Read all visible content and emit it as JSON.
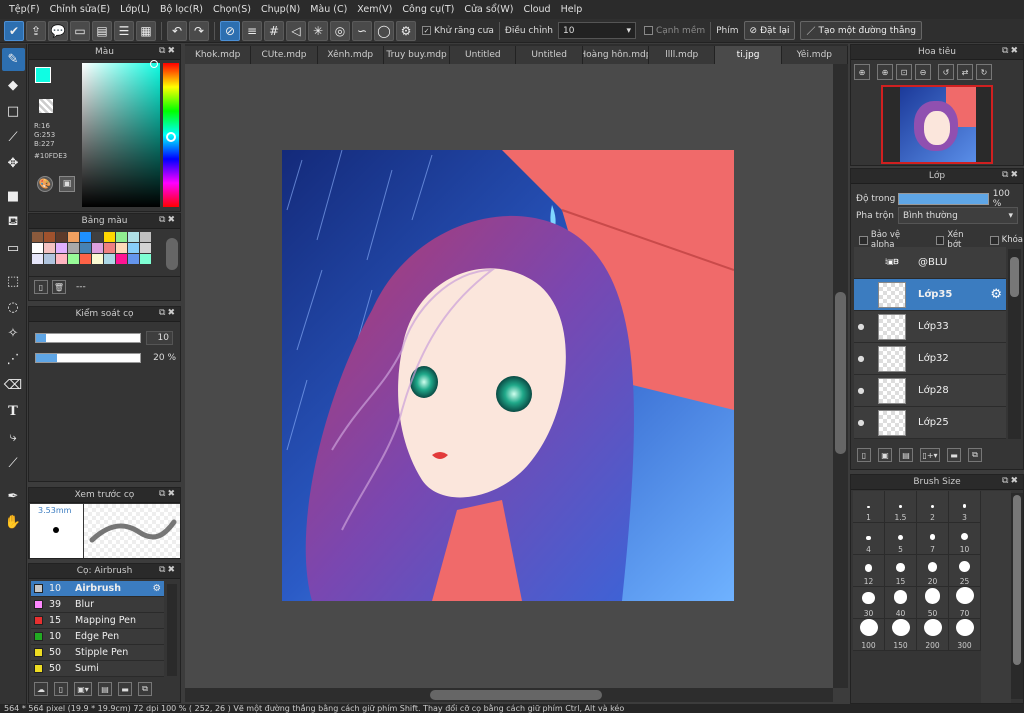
{
  "menu": [
    "Tệp(F)",
    "Chỉnh sửa(E)",
    "Lớp(L)",
    "Bộ lọc(R)",
    "Chọn(S)",
    "Chụp(N)",
    "Màu (C)",
    "Xem(V)",
    "Công cụ(T)",
    "Cửa sổ(W)",
    "Cloud",
    "Help"
  ],
  "toolbar": {
    "antialias_label": "Khử răng cưa",
    "correction_label": "Điều chỉnh",
    "correction_value": "10",
    "soft_label": "Cạnh mềm",
    "snap_label": "Phím",
    "reset_label": "Đặt lại",
    "line_label": "Tạo một đường thẳng"
  },
  "color_panel": {
    "title": "Màu",
    "r": "R:16",
    "g": "G:253",
    "b": "B:227",
    "hex": "#10FDE3",
    "current_color": "#10FDE3"
  },
  "palette_panel": {
    "title": "Bảng màu",
    "footer_text": "---",
    "colors": [
      "#8b5a3c",
      "#a0522d",
      "#5c3a2a",
      "#f0a060",
      "#1e90ff",
      "#404040",
      "#ffd700",
      "#90ee90",
      "#b0e0e6",
      "#c0c0c0",
      "#ffffff",
      "#f4c2c2",
      "#e0b0ff",
      "#a9a9a9",
      "#4682b4",
      "#dda0dd",
      "#f08080",
      "#ffdab9",
      "#87cefa",
      "#d3d3d3",
      "#e6e6fa",
      "#b0c4de",
      "#ffb6c1",
      "#98fb98",
      "#ff6347",
      "#fafad2",
      "#add8e6",
      "#ff1493",
      "#6495ed",
      "#7fffd4"
    ]
  },
  "brush_control": {
    "title": "Kiểm soát cọ",
    "size_value": "10",
    "size_fraction": 0.1,
    "opacity_value": "20 %",
    "opacity_fraction": 0.2
  },
  "preview_panel": {
    "title": "Xem trước cọ",
    "size_text": "3.53mm"
  },
  "brush_panel": {
    "title": "Cọ: Airbrush",
    "items": [
      {
        "size": "10",
        "name": "Airbrush",
        "color": "#c8c8c8"
      },
      {
        "size": "39",
        "name": "Blur",
        "color": "#ff88ff"
      },
      {
        "size": "15",
        "name": "Mapping Pen",
        "color": "#e83030"
      },
      {
        "size": "10",
        "name": "Edge Pen",
        "color": "#22aa22"
      },
      {
        "size": "50",
        "name": "Stipple Pen",
        "color": "#eedd22"
      },
      {
        "size": "50",
        "name": "Sumi",
        "color": "#eedd22"
      }
    ]
  },
  "tabs": [
    "Khok.mdp",
    "CUte.mdp",
    "Xênh.mdp",
    "Truy buy.mdp",
    "Untitled",
    "Untitled",
    "Hoàng hôn.mdp",
    "llll.mdp",
    "ti.jpg",
    "Yêi.mdp"
  ],
  "active_tab_index": 8,
  "navigator": {
    "title": "Hoa tiêu"
  },
  "layer_panel": {
    "title": "Lớp",
    "opacity_label": "Độ trong",
    "opacity_value": "100 %",
    "opacity_fraction": 1.0,
    "blend_label": "Pha trộn",
    "blend_value": "Bình thường",
    "protect_alpha": "Bảo vệ alpha",
    "clipping": "Xén bớt",
    "lock": "Khóa",
    "layers": [
      {
        "name": "@BLU",
        "visible": false,
        "selected": false,
        "thumb": "text"
      },
      {
        "name": "Lớp35",
        "visible": false,
        "selected": true,
        "thumb": "blank"
      },
      {
        "name": "Lớp33",
        "visible": true,
        "selected": false,
        "thumb": "blank"
      },
      {
        "name": "Lớp32",
        "visible": true,
        "selected": false,
        "thumb": "blank"
      },
      {
        "name": "Lớp28",
        "visible": true,
        "selected": false,
        "thumb": "blank"
      },
      {
        "name": "Lớp25",
        "visible": true,
        "selected": false,
        "thumb": "blank"
      }
    ]
  },
  "brush_size_panel": {
    "title": "Brush Size",
    "sizes": [
      "1",
      "1.5",
      "2",
      "3",
      "4",
      "5",
      "7",
      "10",
      "12",
      "15",
      "20",
      "25",
      "30",
      "40",
      "50",
      "70",
      "100",
      "150",
      "200",
      "300"
    ]
  },
  "status_text": "564 * 564 pixel   (19.9 * 19.9cm)   72 dpi   100 %   ( 252, 26 )   Vẽ một đường thẳng bằng cách giữ phím Shift. Thay đổi cỡ cọ bằng cách giữ phím Ctrl, Alt và kéo"
}
